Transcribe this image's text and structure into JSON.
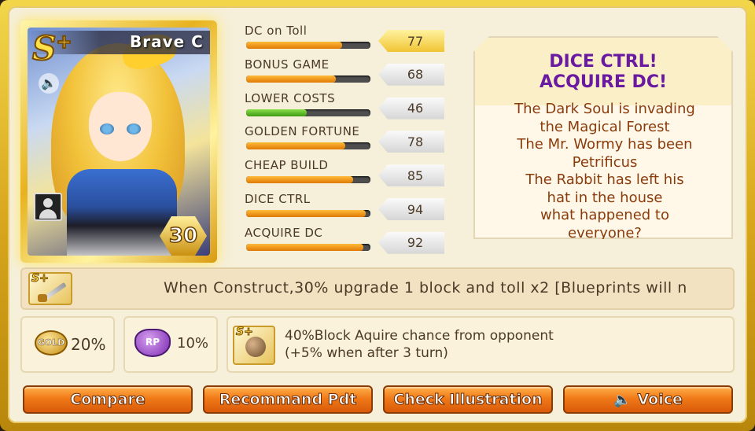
{
  "card": {
    "rank": "S",
    "rank_plus": "+",
    "name": "Brave C",
    "level": "30"
  },
  "stats": [
    {
      "label": "DC on Toll",
      "value": "77",
      "fill": 0.77,
      "highlight": true
    },
    {
      "label": "BONUS GAME",
      "value": "68",
      "fill": 0.72,
      "highlight": false
    },
    {
      "label": "LOWER COSTS",
      "value": "46",
      "fill": 0.49,
      "highlight": false,
      "color": "green"
    },
    {
      "label": "GOLDEN FORTUNE",
      "value": "78",
      "fill": 0.8,
      "highlight": false
    },
    {
      "label": "CHEAP BUILD",
      "value": "85",
      "fill": 0.86,
      "highlight": false
    },
    {
      "label": "DICE CTRL",
      "value": "94",
      "fill": 0.96,
      "highlight": false
    },
    {
      "label": "ACQUIRE DC",
      "value": "92",
      "fill": 0.94,
      "highlight": false
    }
  ],
  "description": {
    "title_line1": "DICE CTRL!",
    "title_line2": "ACQUIRE DC!",
    "body_lines": [
      "The Dark Soul is invading",
      "the Magical Forest",
      "The Mr. Wormy has been",
      "Petrificus",
      "The Rabbit has left his",
      "hat in the house",
      "what happened to",
      "everyone?"
    ]
  },
  "skill": {
    "text": "When Construct,30% upgrade 1 block and toll x2 [Blueprints will n"
  },
  "bonuses": {
    "gold_icon": "GOLD",
    "gold_value": "20%",
    "rp_icon": "RP",
    "rp_value": "10%",
    "block_line1": "40%Block Aquire chance from opponent",
    "block_line2": "(+5% when after 3 turn)"
  },
  "buttons": {
    "compare": "Compare",
    "recommand": "Recommand Pdt",
    "illustration": "Check Illustration",
    "voice": "Voice"
  },
  "colors": {
    "title_purple": "#6a1aa0",
    "body_brown": "#8a3b0c",
    "button_orange": "#f07a18",
    "bar_orange": "#e07a05",
    "bar_green": "#3e9a12"
  }
}
